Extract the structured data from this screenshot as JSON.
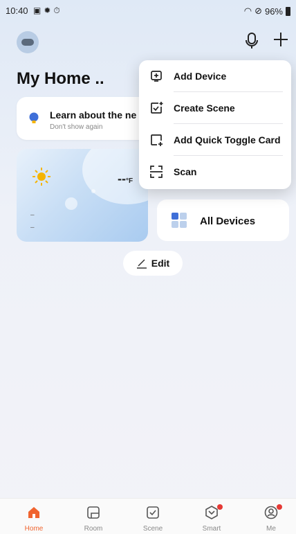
{
  "status_bar": {
    "time": "10:40",
    "battery": "96%",
    "left_icons": [
      "image-icon",
      "gear-icon",
      "timer-icon"
    ],
    "right_icons": [
      "wifi-icon",
      "dnd-icon",
      "battery-icon"
    ]
  },
  "header": {
    "home_name": "My Home ..",
    "avatar_icon": "robot-avatar-icon",
    "mic_icon": "microphone-icon",
    "add_icon": "plus-icon"
  },
  "learn_card": {
    "title": "Learn about the ne",
    "subtitle": "Don't show again",
    "icon": "lightbulb-icon"
  },
  "weather": {
    "temperature": "--",
    "unit": "°F",
    "line1": "–",
    "line2": "–",
    "icon": "sun-icon"
  },
  "all_devices": {
    "label": "All Devices",
    "icon": "device-grid-icon"
  },
  "edit": {
    "label": "Edit",
    "icon": "pencil-icon"
  },
  "menu": {
    "items": [
      {
        "label": "Add Device",
        "icon": "add-device-icon"
      },
      {
        "label": "Create Scene",
        "icon": "create-scene-icon"
      },
      {
        "label": "Add Quick Toggle Card",
        "icon": "add-card-icon"
      },
      {
        "label": "Scan",
        "icon": "scan-icon"
      }
    ]
  },
  "tabs": [
    {
      "label": "Home",
      "active": true
    },
    {
      "label": "Room"
    },
    {
      "label": "Scene"
    },
    {
      "label": "Smart",
      "badge": true
    },
    {
      "label": "Me",
      "badge": true
    }
  ],
  "colors": {
    "accent": "#f0642f",
    "badge": "#e53935",
    "bulb": "#3f6fd8",
    "sun": "#f5b400"
  }
}
